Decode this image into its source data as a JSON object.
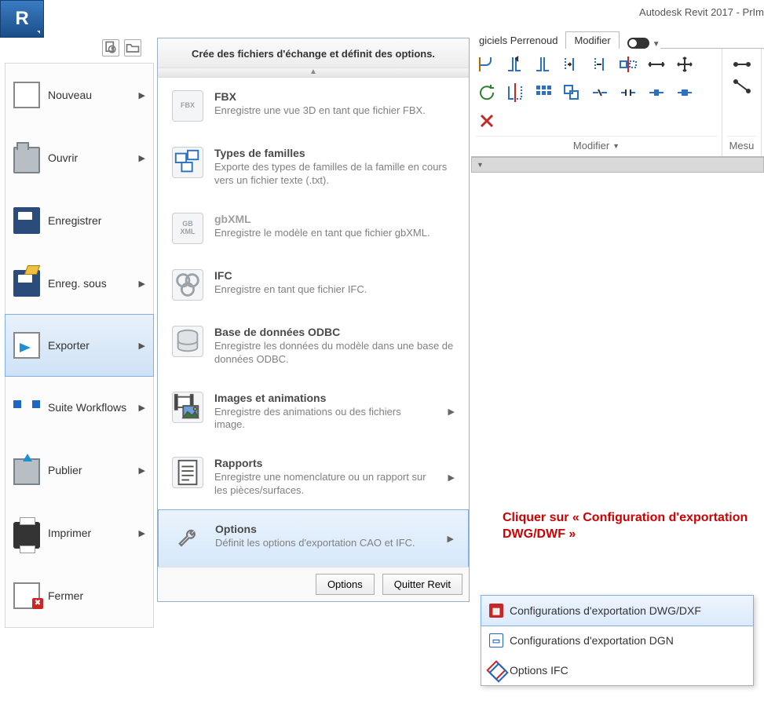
{
  "title": "Autodesk Revit 2017 -    PrIm",
  "left_menu": {
    "items": [
      {
        "label": "Nouveau",
        "arrow": true
      },
      {
        "label": "Ouvrir",
        "arrow": true
      },
      {
        "label": "Enregistrer",
        "arrow": false
      },
      {
        "label": "Enreg. sous",
        "arrow": true
      },
      {
        "label": "Exporter",
        "arrow": true,
        "selected": true
      },
      {
        "label": "Suite Workflows",
        "arrow": true
      },
      {
        "label": "Publier",
        "arrow": true
      },
      {
        "label": "Imprimer",
        "arrow": true
      },
      {
        "label": "Fermer",
        "arrow": false
      }
    ]
  },
  "export_panel": {
    "header": "Crée des fichiers d'échange et définit des options.",
    "items": [
      {
        "title": "FBX",
        "desc": "Enregistre une vue 3D en tant que fichier FBX.",
        "icon": "FBX"
      },
      {
        "title": "Types de familles",
        "desc": "Exporte des types de familles de la famille en cours vers un fichier texte (.txt).",
        "icon": "FAM"
      },
      {
        "title": "gbXML",
        "desc": "Enregistre le modèle en tant que fichier gbXML.",
        "icon": "GB\nXML",
        "disabled": true
      },
      {
        "title": "IFC",
        "desc": "Enregistre en tant que fichier IFC.",
        "icon": "IFC"
      },
      {
        "title": "Base de données ODBC",
        "desc": "Enregistre les données du modèle dans une base de données ODBC.",
        "icon": "DB"
      },
      {
        "title": "Images et animations",
        "desc": "Enregistre des animations ou des fichiers image.",
        "icon": "IMG",
        "arrow": true
      },
      {
        "title": "Rapports",
        "desc": "Enregistre une nomenclature ou un rapport sur les pièces/surfaces.",
        "icon": "RPT",
        "arrow": true
      },
      {
        "title": "Options",
        "desc": "Définit les options d'exportation CAO et IFC.",
        "icon": "wrench",
        "arrow": true,
        "selected": true
      }
    ],
    "footer": {
      "options": "Options",
      "quit": "Quitter Revit"
    }
  },
  "ribbon": {
    "tabs": {
      "left": "giciels Perrenoud",
      "active": "Modifier"
    },
    "panels": {
      "modify": "Modifier",
      "measure": "Mesu"
    }
  },
  "instruction": "Cliquer sur « Configuration d'exportation DWG/DWF »",
  "flyout": {
    "items": [
      {
        "label": "Configurations d'exportation DWG/DXF",
        "icon": "DWG",
        "selected": true
      },
      {
        "label": "Configurations d'exportation DGN",
        "icon": "DGN"
      },
      {
        "label": "Options IFC",
        "icon": "IFC"
      }
    ]
  }
}
